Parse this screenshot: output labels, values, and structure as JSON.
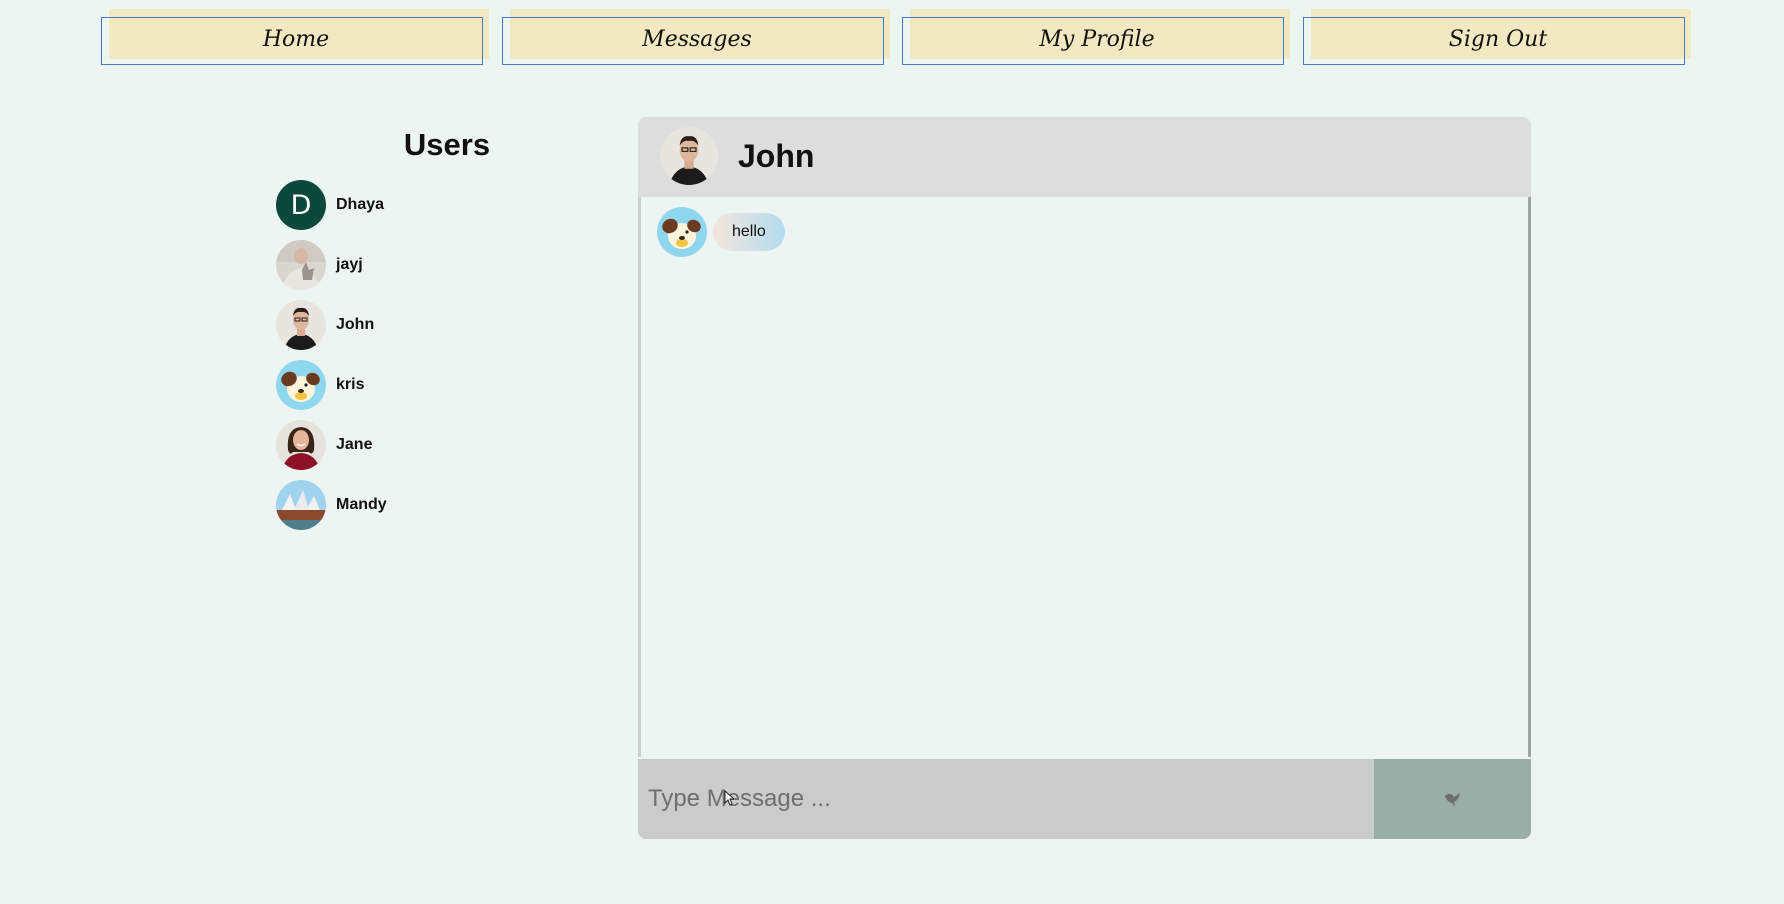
{
  "nav": {
    "items": [
      {
        "label": "Home",
        "icon": "home"
      },
      {
        "label": "Messages",
        "icon": "messages"
      },
      {
        "label": "My Profile",
        "icon": "profile"
      },
      {
        "label": "Sign Out",
        "icon": "sign-out"
      }
    ],
    "colors": {
      "fill": "#f2e9c2",
      "outline": "#4f79c0"
    }
  },
  "sidebar": {
    "title": "Users",
    "users": [
      {
        "name": "Dhaya",
        "avatar": "initial-letter",
        "initial": "D",
        "color": "#0b4a3a"
      },
      {
        "name": "jayj",
        "avatar": "photo-man-with-cat"
      },
      {
        "name": "John",
        "avatar": "photo-man-glasses"
      },
      {
        "name": "kris",
        "avatar": "cartoon-dog"
      },
      {
        "name": "Jane",
        "avatar": "photo-woman-smiling"
      },
      {
        "name": "Mandy",
        "avatar": "photo-opera-house"
      }
    ]
  },
  "chat": {
    "title": "John",
    "header_avatar": "photo-man-glasses",
    "messages": [
      {
        "sender_avatar": "cartoon-dog",
        "text": "hello"
      }
    ],
    "composer": {
      "placeholder": "Type Message ...",
      "send_icon": "send-bird-icon"
    }
  },
  "colors": {
    "page_background": "#ecf5f2",
    "header_background": "#dddddd",
    "input_background": "#cbcbcb",
    "send_button": "#98aea6"
  }
}
